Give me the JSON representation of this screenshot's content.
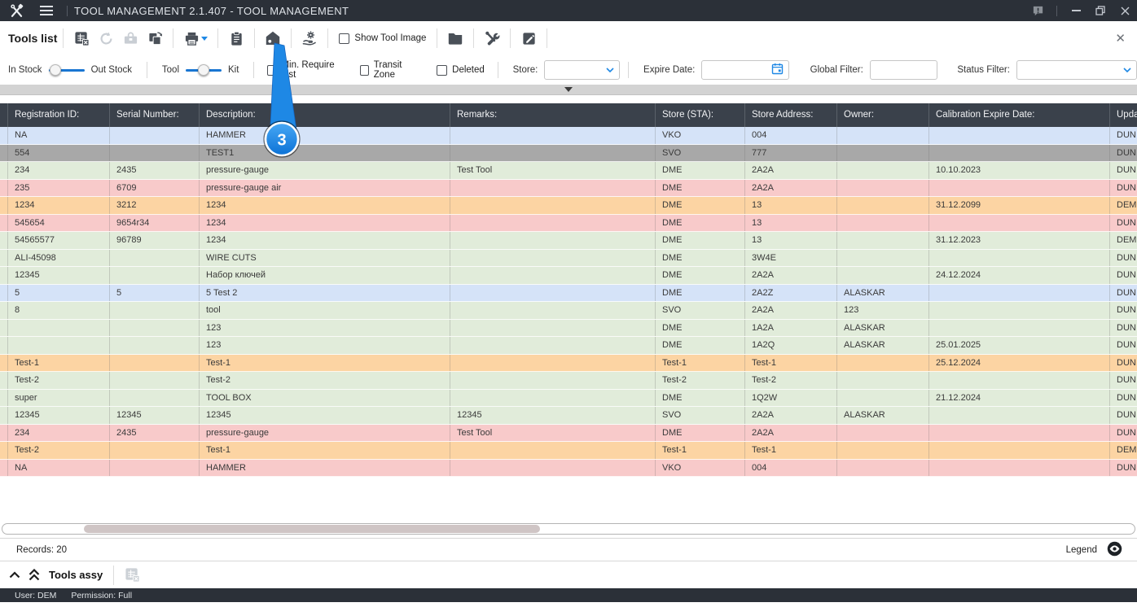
{
  "titlebar": {
    "title": "TOOL MANAGEMENT 2.1.407 - TOOL MANAGEMENT"
  },
  "toolbar": {
    "panel_title": "Tools list",
    "show_tool_image_label": "Show Tool Image",
    "icon_names": [
      "export-excel-icon",
      "refresh-icon",
      "toolbox-icon",
      "copy-icon",
      "print-icon",
      "paste-icon",
      "home-icon",
      "hand-gear-icon",
      "folder-icon",
      "tools-icon",
      "edit-clipboard-icon",
      "close-icon"
    ]
  },
  "filters": {
    "in_stock_label": "In Stock",
    "out_stock_label": "Out Stock",
    "tool_label": "Tool",
    "kit_label": "Kit",
    "min_require_list_label": "Min. Require List",
    "transit_zone_label": "Transit Zone",
    "deleted_label": "Deleted",
    "store_label": "Store:",
    "store_value": "",
    "expire_date_label": "Expire Date:",
    "expire_date_value": "",
    "global_filter_label": "Global Filter:",
    "global_filter_value": "",
    "status_filter_label": "Status Filter:",
    "status_filter_value": ""
  },
  "callout": {
    "step_number": "3"
  },
  "colors": {
    "blue": "#d5e3f8",
    "gray": "#a8a8a8",
    "green": "#e1ecda",
    "pink": "#f8caca",
    "orange": "#fcd4a3",
    "accent": "#1e88e5",
    "titlebar": "#2b3038",
    "table_header": "#3a414b"
  },
  "table": {
    "columns": [
      "Registration ID:",
      "Serial Number:",
      "Description:",
      "Remarks:",
      "Store (STA):",
      "Store Address:",
      "Owner:",
      "Calibration Expire Date:",
      "Upda"
    ],
    "rows": [
      {
        "color": "blue",
        "cells": [
          "NA",
          "",
          "HAMMER",
          "",
          "VKO",
          "004",
          "",
          "",
          "DUN"
        ]
      },
      {
        "color": "gray",
        "cells": [
          "554",
          "",
          "TEST1",
          "",
          "SVO",
          "777",
          "",
          "",
          "DUN"
        ]
      },
      {
        "color": "green",
        "cells": [
          "234",
          "2435",
          "pressure-gauge",
          "Test Tool",
          "DME",
          "2A2A",
          "",
          "10.10.2023",
          "DUN"
        ]
      },
      {
        "color": "pink",
        "cells": [
          "235",
          "6709",
          "pressure-gauge air",
          "",
          "DME",
          "2A2A",
          "",
          "",
          "DUN"
        ]
      },
      {
        "color": "orange",
        "cells": [
          "1234",
          "3212",
          "1234",
          "",
          "DME",
          "13",
          "",
          "31.12.2099",
          "DEM"
        ]
      },
      {
        "color": "pink",
        "cells": [
          "545654",
          "9654r34",
          "1234",
          "",
          "DME",
          "13",
          "",
          "",
          "DUN"
        ]
      },
      {
        "color": "green",
        "cells": [
          "54565577",
          "96789",
          "1234",
          "",
          "DME",
          "13",
          "",
          "31.12.2023",
          "DEM"
        ]
      },
      {
        "color": "green",
        "cells": [
          "ALI-45098",
          "",
          "WIRE CUTS",
          "",
          "DME",
          "3W4E",
          "",
          "",
          "DUN"
        ]
      },
      {
        "color": "green",
        "cells": [
          "12345",
          "",
          "Набор ключей",
          "",
          "DME",
          "2A2A",
          "",
          "24.12.2024",
          "DUN"
        ]
      },
      {
        "color": "blue",
        "cells": [
          "5",
          "5",
          "5 Test 2",
          "",
          "DME",
          "2A2Z",
          "ALASKAR",
          "",
          "DUN"
        ]
      },
      {
        "color": "green",
        "cells": [
          "8",
          "",
          "tool",
          "",
          "SVO",
          "2A2A",
          "123",
          "",
          "DUN"
        ]
      },
      {
        "color": "green",
        "cells": [
          "",
          "",
          "123",
          "",
          "DME",
          "1A2A",
          "ALASKAR",
          "",
          "DUN"
        ]
      },
      {
        "color": "green",
        "cells": [
          "",
          "",
          "123",
          "",
          "DME",
          "1A2Q",
          "ALASKAR",
          "25.01.2025",
          "DUN"
        ]
      },
      {
        "color": "orange",
        "cells": [
          "Test-1",
          "",
          "Test-1",
          "",
          "Test-1",
          "Test-1",
          "",
          "25.12.2024",
          "DUN"
        ]
      },
      {
        "color": "green",
        "cells": [
          "Test-2",
          "",
          "Test-2",
          "",
          "Test-2",
          "Test-2",
          "",
          "",
          "DUN"
        ]
      },
      {
        "color": "green",
        "cells": [
          "super",
          "",
          "TOOL BOX",
          "",
          "DME",
          "1Q2W",
          "",
          "21.12.2024",
          "DUN"
        ]
      },
      {
        "color": "green",
        "cells": [
          "12345",
          "12345",
          "12345",
          "12345",
          "SVO",
          "2A2A",
          "ALASKAR",
          "",
          "DUN"
        ]
      },
      {
        "color": "pink",
        "cells": [
          "234",
          "2435",
          "pressure-gauge",
          "Test Tool",
          "DME",
          "2A2A",
          "",
          "",
          "DUN"
        ]
      },
      {
        "color": "orange",
        "cells": [
          "Test-2",
          "",
          "Test-1",
          "",
          "Test-1",
          "Test-1",
          "",
          "",
          "DEM"
        ]
      },
      {
        "color": "pink",
        "cells": [
          "NA",
          "",
          "HAMMER",
          "",
          "VKO",
          "004",
          "",
          "",
          "DUN"
        ]
      }
    ]
  },
  "footer": {
    "records_label": "Records: 20",
    "legend_label": "Legend"
  },
  "tools_assy": {
    "title": "Tools assy"
  },
  "statusbar": {
    "user": "User: DEM",
    "permission": "Permission: Full"
  }
}
